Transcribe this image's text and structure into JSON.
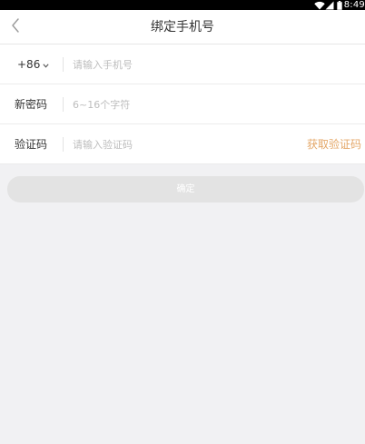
{
  "status_bar": {
    "time": "8:49",
    "icons": [
      "wifi-icon",
      "signal-icon",
      "battery-icon"
    ]
  },
  "nav": {
    "title": "绑定手机号",
    "back_icon": "chevron-left-icon"
  },
  "form": {
    "phone": {
      "country_code": "+86",
      "dropdown_icon": "chevron-down-icon",
      "placeholder": "请输入手机号",
      "value": ""
    },
    "password": {
      "label": "新密码",
      "placeholder": "6~16个字符",
      "value": ""
    },
    "verify": {
      "label": "验证码",
      "placeholder": "请输入验证码",
      "value": "",
      "get_code_label": "获取验证码"
    }
  },
  "confirm_button": {
    "label": "确定"
  },
  "colors": {
    "background": "#f1f1f3",
    "accent": "#e4a768",
    "button_disabled": "#e3e3e3",
    "placeholder": "#bdbdbd"
  }
}
